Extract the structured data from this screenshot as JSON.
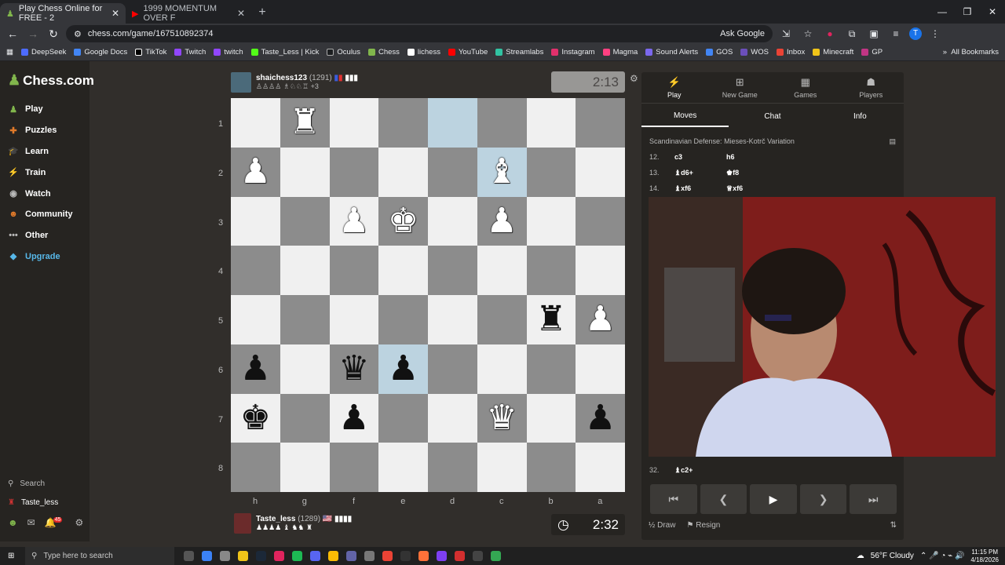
{
  "browser": {
    "tabs": [
      {
        "title": "Play Chess Online for FREE - 2",
        "active": true
      },
      {
        "title": "1999 MOMENTUM OVER F",
        "active": false
      }
    ],
    "url": "chess.com/game/167510892374",
    "ask_google": "Ask Google",
    "profile_letter": "T",
    "bookmarks": [
      "DeepSeek",
      "Google Docs",
      "TikTok",
      "Twitch",
      "twitch",
      "Taste_Less | Kick",
      "Oculus",
      "Chess",
      "lichess",
      "YouTube",
      "Streamlabs",
      "Instagram",
      "Magma",
      "Sound Alerts",
      "GOS",
      "WOS",
      "Inbox",
      "Minecraft",
      "GP"
    ],
    "all_bookmarks": "All Bookmarks"
  },
  "sidebar": {
    "logo": "Chess.com",
    "items": [
      {
        "icon": "play-icon",
        "glyph": "♟",
        "label": "Play",
        "color": "#81b64c"
      },
      {
        "icon": "puzzles-icon",
        "glyph": "✚",
        "label": "Puzzles",
        "color": "#e07a2a"
      },
      {
        "icon": "learn-icon",
        "glyph": "🎓",
        "label": "Learn",
        "color": "#57b7e8"
      },
      {
        "icon": "train-icon",
        "glyph": "⚡",
        "label": "Train",
        "color": "#bababa"
      },
      {
        "icon": "watch-icon",
        "glyph": "◉",
        "label": "Watch",
        "color": "#bababa"
      },
      {
        "icon": "community-icon",
        "glyph": "☻",
        "label": "Community",
        "color": "#e07a2a"
      },
      {
        "icon": "other-icon",
        "glyph": "•••",
        "label": "Other",
        "color": "#bababa"
      },
      {
        "icon": "upgrade-icon",
        "glyph": "◆",
        "label": "Upgrade",
        "color": "#57b7e8"
      }
    ],
    "search": "Search",
    "user": "Taste_less",
    "notif_count": "45"
  },
  "top_player": {
    "name": "shaichess123",
    "rating": "(1291)",
    "captured": "+3",
    "clock": "2:13"
  },
  "bottom_player": {
    "name": "Taste_less",
    "rating": "(1289)",
    "clock": "2:32"
  },
  "board": {
    "ranks": [
      "1",
      "2",
      "3",
      "4",
      "5",
      "6",
      "7",
      "8"
    ],
    "files": [
      "h",
      "g",
      "f",
      "e",
      "d",
      "c",
      "b",
      "a"
    ],
    "squares": [
      [
        "",
        "wR",
        "",
        "",
        "",
        "",
        "",
        ""
      ],
      [
        "wP",
        "",
        "",
        "",
        "",
        "wB",
        "",
        ""
      ],
      [
        "",
        "",
        "wP",
        "wK",
        "",
        "wP",
        "",
        ""
      ],
      [
        "",
        "",
        "",
        "",
        "",
        "",
        "",
        ""
      ],
      [
        "",
        "",
        "",
        "",
        "",
        "",
        "bR",
        "wP"
      ],
      [
        "bP",
        "",
        "bQ",
        "bP",
        "",
        "",
        "",
        ""
      ],
      [
        "bK",
        "",
        "bP",
        "",
        "",
        "wQ",
        "",
        "bP"
      ],
      [
        "",
        "",
        "",
        "",
        "",
        "",
        "",
        ""
      ]
    ],
    "highlight": [
      "0-4",
      "1-5",
      "5-3"
    ]
  },
  "panel": {
    "tabs": [
      {
        "icon": "play-bolt-icon",
        "glyph": "⚡",
        "label": "Play"
      },
      {
        "icon": "new-game-icon",
        "glyph": "⊞",
        "label": "New Game"
      },
      {
        "icon": "games-icon",
        "glyph": "▦",
        "label": "Games"
      },
      {
        "icon": "players-icon",
        "glyph": "☗",
        "label": "Players"
      }
    ],
    "subtabs": [
      "Moves",
      "Chat",
      "Info"
    ],
    "opening": "Scandinavian Defense: Mieses-Kotrč Variation",
    "moves": [
      {
        "n": "12.",
        "w": "c3",
        "b": "h6"
      },
      {
        "n": "13.",
        "w": "♝d6+",
        "b": "♚f8"
      },
      {
        "n": "14.",
        "w": "♝xf6",
        "b": "♕xf6"
      }
    ],
    "last_move": {
      "n": "32.",
      "w": "♝c2+"
    },
    "draw": "Draw",
    "resign": "Resign"
  },
  "taskbar": {
    "search_placeholder": "Type here to search",
    "weather": "56°F  Cloudy",
    "time": "11:15 PM",
    "date": "4/18/2026"
  }
}
